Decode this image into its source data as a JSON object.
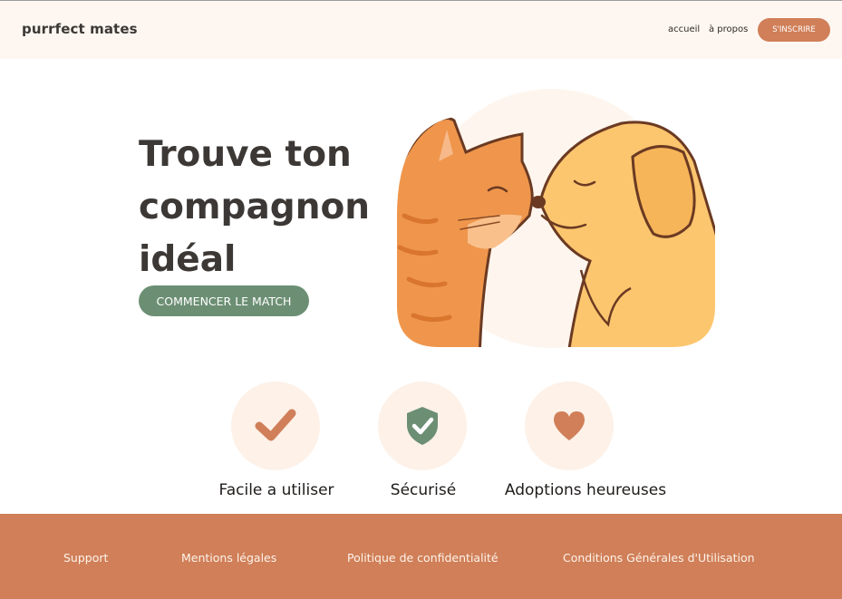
{
  "header": {
    "logo": "purrfect mates",
    "nav": {
      "home": "accueil",
      "about": "à propos"
    },
    "signup_label": "S'INSCRIRE"
  },
  "hero": {
    "title_lines": [
      "Trouve ton",
      "compagnon",
      "idéal"
    ],
    "cta_label": "COMMENCER LE MATCH",
    "illustration": "cat-and-dog-nose-to-nose"
  },
  "features": [
    {
      "icon": "check-icon",
      "label": "Facile a utiliser"
    },
    {
      "icon": "shield-check-icon",
      "label": "Sécurisé"
    },
    {
      "icon": "heart-icon",
      "label": "Adoptions heureuses"
    }
  ],
  "footer": {
    "links": [
      "Support",
      "Mentions légales",
      "Politique de confidentialité",
      "Conditions Générales d'Utilisation"
    ]
  },
  "colors": {
    "accent": "#d07f58",
    "green": "#6c8f74",
    "header_bg": "#fef7f1",
    "icon_circle": "#fdf1e8",
    "footer_bg": "#d07f58"
  }
}
